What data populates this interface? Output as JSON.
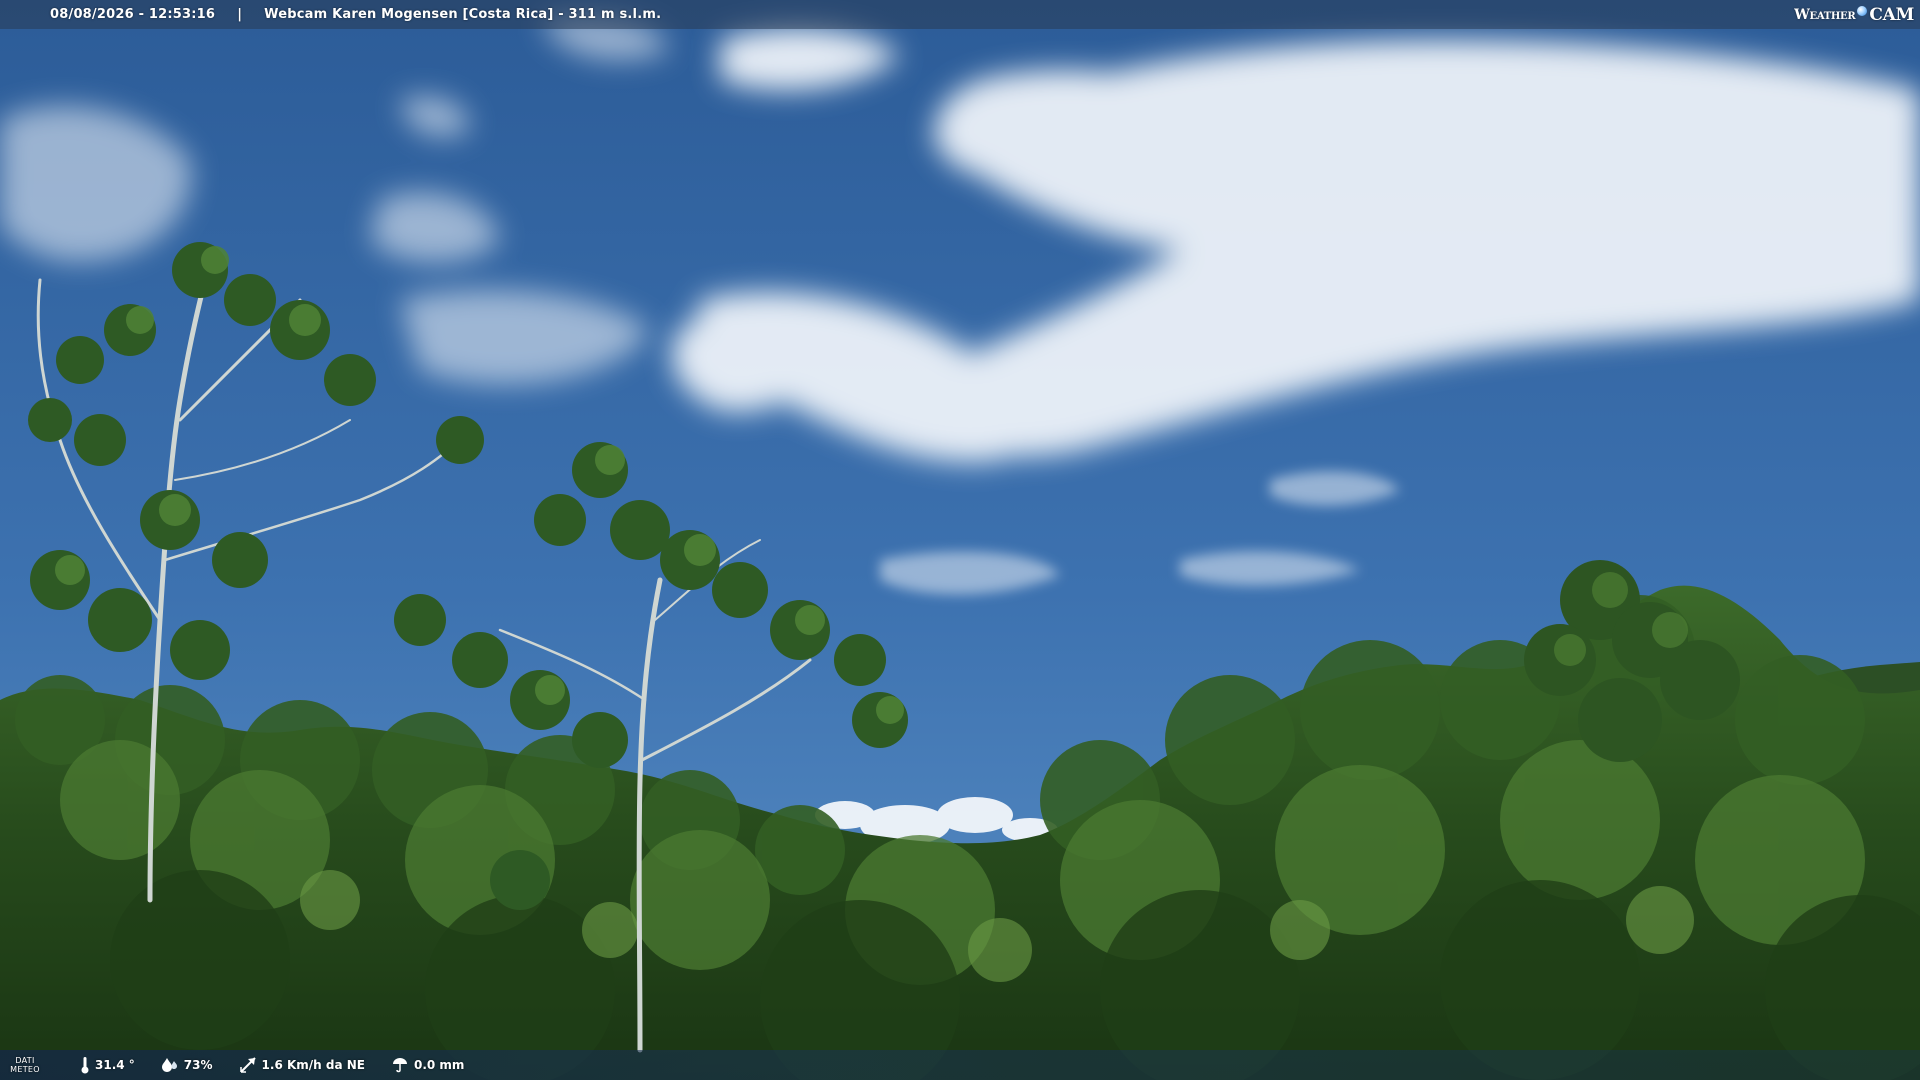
{
  "header": {
    "datetime": "08/08/2026 - 12:53:16",
    "separator": "|",
    "title": "Webcam Karen Mogensen [Costa Rica] - 311 m s.l.m."
  },
  "brand": {
    "prefix": "Weather",
    "suffix": "CAM"
  },
  "meteo": {
    "label_line1": "DATI",
    "label_line2": "METEO",
    "temperature": "31.4 °",
    "humidity": "73%",
    "wind": "1.6 Km/h da NE",
    "rain": "0.0 mm"
  },
  "icons": {
    "temperature": "thermometer-icon",
    "humidity": "humidity-drop-icon",
    "wind": "wind-direction-icon",
    "rain": "rain-icon"
  },
  "colors": {
    "sky_top": "#2f5f9a",
    "sky_bottom": "#4f86c0",
    "cloud": "#f4f7fb",
    "foliage_dark": "#1d3a17",
    "foliage_mid": "#2f5a22",
    "foliage_light": "#5f8c3a"
  }
}
